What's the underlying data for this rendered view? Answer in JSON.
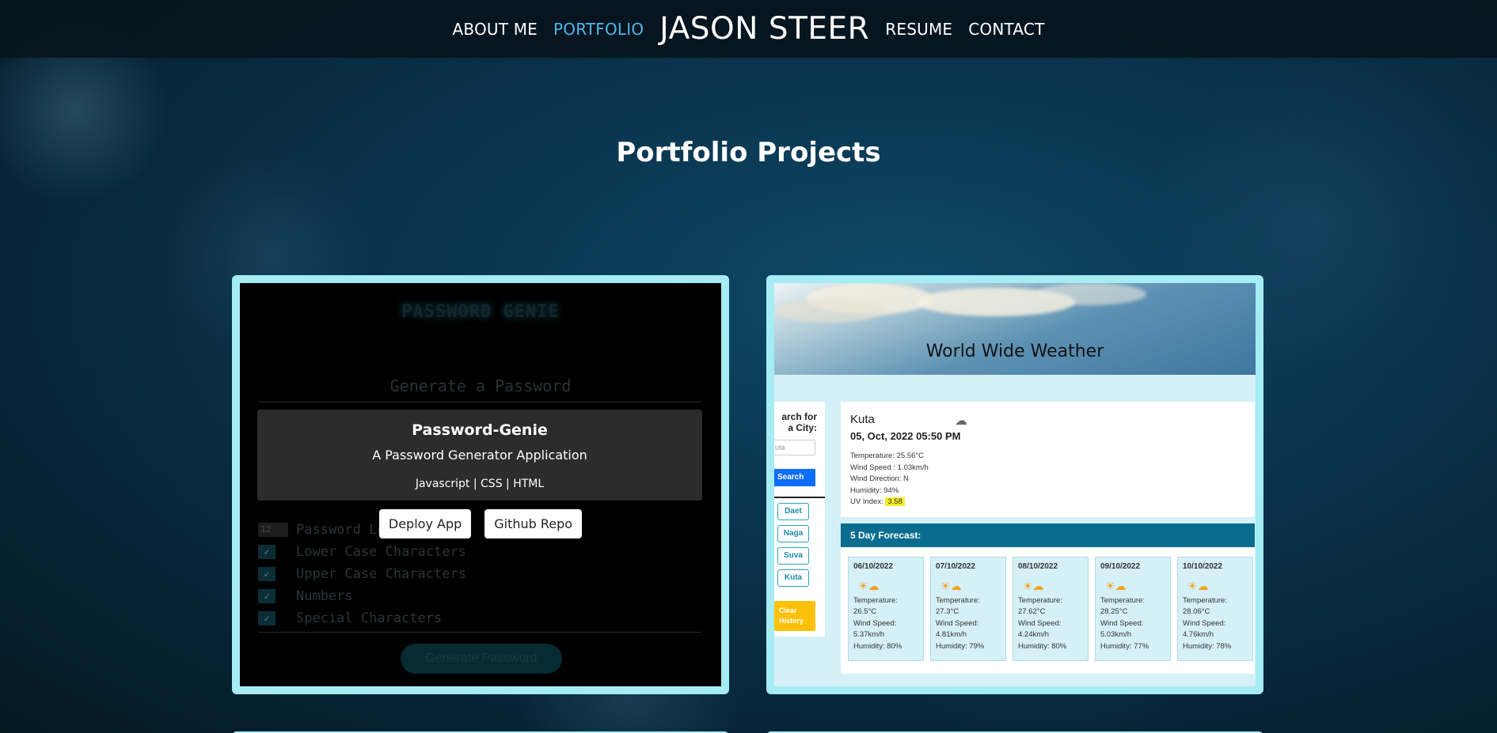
{
  "nav": {
    "about": "ABOUT ME",
    "portfolio": "PORTFOLIO",
    "brand": "JASON STEER",
    "resume": "RESUME",
    "contact": "CONTACT"
  },
  "page_title": "Portfolio Projects",
  "colors": {
    "accent": "#4fb6ea",
    "card_border": "#a6ecf4"
  },
  "projects": [
    {
      "name": "Password-Genie",
      "description": "A Password Generator Application",
      "tech": "Javascript | CSS | HTML",
      "buttons": {
        "deploy": "Deploy App",
        "repo": "Github Repo"
      },
      "screenshot": {
        "title": "PASSWORD GENIE",
        "subtitle": "Generate a Password",
        "length_value": "12",
        "options": [
          "Password Le",
          "Lower Case Characters",
          "Upper Case Characters",
          "Numbers",
          "Special Characters"
        ],
        "generate": "Generate Password"
      }
    },
    {
      "screenshot": {
        "title": "World Wide Weather",
        "side_label": "arch for a City:",
        "input_placeholder": "uta",
        "search": "Search",
        "cities": [
          "Daet",
          "Naga",
          "Suva",
          "Kuta"
        ],
        "clear": "Clear History",
        "current": {
          "city": "Kuta",
          "date": "05, Oct, 2022 05:50 PM",
          "temp": "Temperature: 25.56°C",
          "wind": "Wind Speed : 1.03km/h",
          "dir": "Wind Direction: N",
          "humidity": "Humidity: 94%",
          "uv_label": "UV Index:",
          "uv_value": "3.58"
        },
        "forecast_title": "5 Day Forecast:",
        "forecast": [
          {
            "date": "06/10/2022",
            "temp": "26.5°C",
            "wind": "5.37km/h",
            "humidity": "Humidity: 80%"
          },
          {
            "date": "07/10/2022",
            "temp": "27.3°C",
            "wind": "4.81km/h",
            "humidity": "Humidity: 79%"
          },
          {
            "date": "08/10/2022",
            "temp": "27.62°C",
            "wind": "4.24km/h",
            "humidity": "Humidity: 80%"
          },
          {
            "date": "09/10/2022",
            "temp": "28.25°C",
            "wind": "5.03km/h",
            "humidity": "Humidity: 77%"
          },
          {
            "date": "10/10/2022",
            "temp": "28.06°C",
            "wind": "4.76km/h",
            "humidity": "Humidity: 78%"
          }
        ],
        "labels": {
          "temperature": "Temperature:",
          "wind": "Wind Speed:"
        }
      }
    }
  ]
}
